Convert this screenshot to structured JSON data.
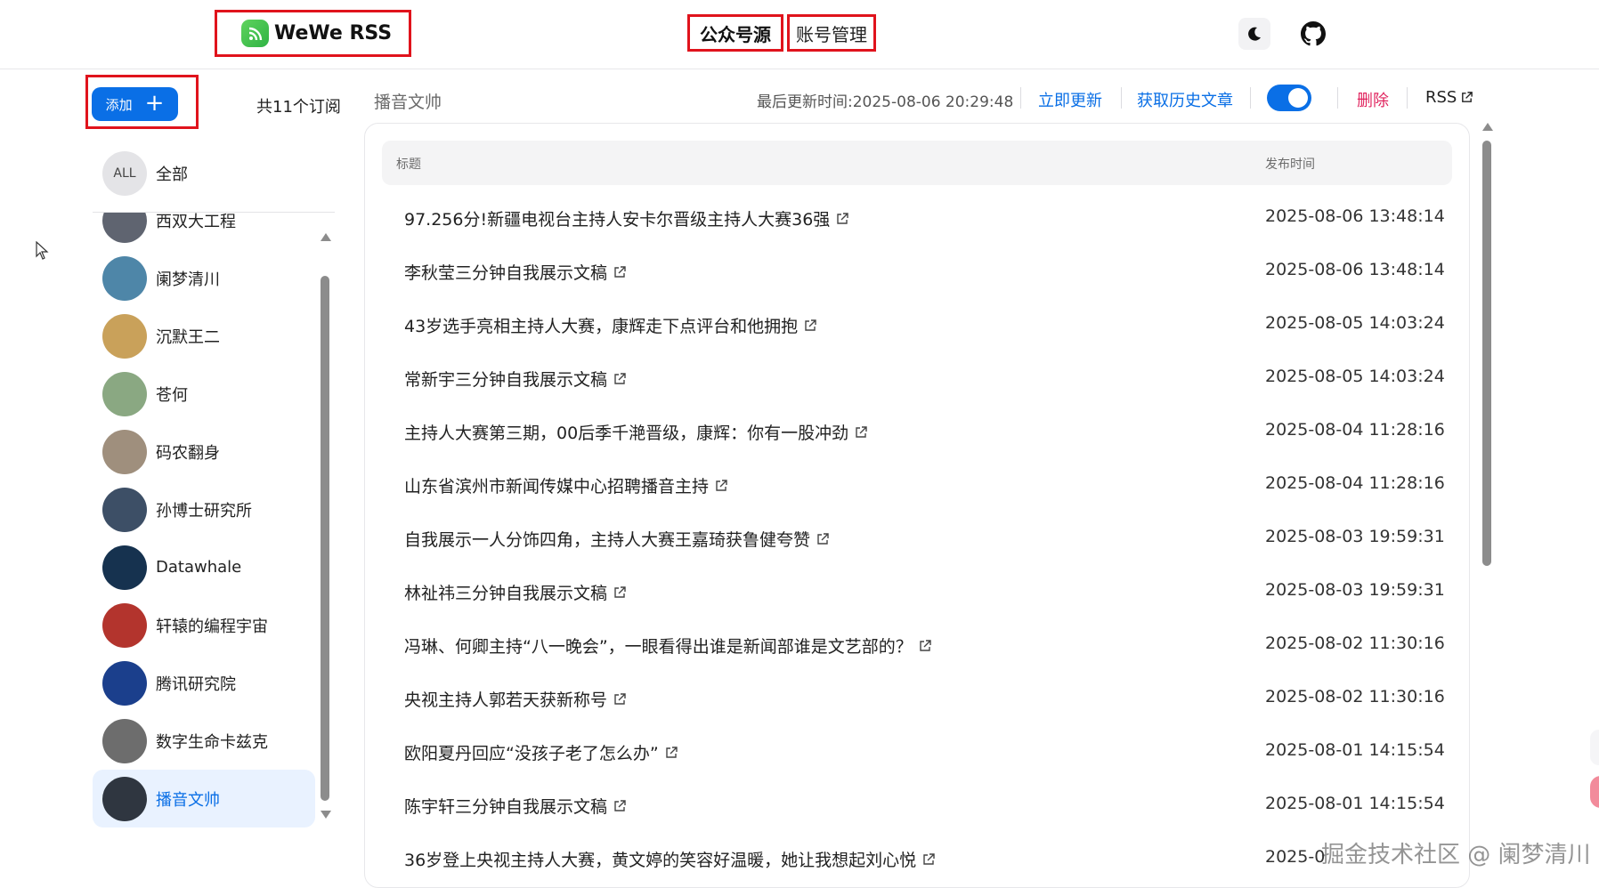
{
  "header": {
    "brand": "WeWe RSS",
    "tabs": [
      {
        "label": "公众号源",
        "active": true
      },
      {
        "label": "账号管理",
        "active": false
      }
    ],
    "icons": [
      "moon-icon",
      "github-icon"
    ]
  },
  "sidebar": {
    "add_label": "添加",
    "add_icon": "+",
    "subscription_count": "共11个订阅",
    "all_item": {
      "avatar": "ALL",
      "label": "全部"
    },
    "items": [
      {
        "label": "西双大工程",
        "color": "#5f6470"
      },
      {
        "label": "阑梦清川",
        "color": "#4e86a8"
      },
      {
        "label": "沉默王二",
        "color": "#c9a15a"
      },
      {
        "label": "苍何",
        "color": "#8aa882"
      },
      {
        "label": "码农翻身",
        "color": "#9f8f7d"
      },
      {
        "label": "孙博士研究所",
        "color": "#3d4f66"
      },
      {
        "label": "Datawhale",
        "color": "#16324f"
      },
      {
        "label": "轩辕的编程宇宙",
        "color": "#b3342d"
      },
      {
        "label": "腾讯研究院",
        "color": "#1b3f8c"
      },
      {
        "label": "数字生命卡兹克",
        "color": "#6d6d6d"
      },
      {
        "label": "播音文帅",
        "color": "#2f3640",
        "active": true
      }
    ]
  },
  "main": {
    "feed_title": "播音文帅",
    "last_update": "最后更新时间:2025-08-06 20:29:48",
    "update_now": "立即更新",
    "fetch_history": "获取历史文章",
    "toggle_on": true,
    "delete": "删除",
    "rss": "RSS",
    "columns": {
      "title": "标题",
      "time": "发布时间"
    },
    "rows": [
      {
        "title": "97.256分!新疆电视台主持人安卡尔晋级主持人大赛36强",
        "time": "2025-08-06 13:48:14"
      },
      {
        "title": "李秋莹三分钟自我展示文稿",
        "time": "2025-08-06 13:48:14"
      },
      {
        "title": "43岁选手亮相主持人大赛，康辉走下点评台和他拥抱",
        "time": "2025-08-05 14:03:24"
      },
      {
        "title": "常新宇三分钟自我展示文稿",
        "time": "2025-08-05 14:03:24"
      },
      {
        "title": "主持人大赛第三期，00后季千滟晋级，康辉：你有一股冲劲",
        "time": "2025-08-04 11:28:16"
      },
      {
        "title": "山东省滨州市新闻传媒中心招聘播音主持",
        "time": "2025-08-04 11:28:16"
      },
      {
        "title": "自我展示一人分饰四角，主持人大赛王嘉琦获鲁健夸赞",
        "time": "2025-08-03 19:59:31"
      },
      {
        "title": "林祉祎三分钟自我展示文稿",
        "time": "2025-08-03 19:59:31"
      },
      {
        "title": "冯琳、何卿主持“八一晚会”，一眼看得出谁是新闻部谁是文艺部的？",
        "time": "2025-08-02 11:30:16"
      },
      {
        "title": "央视主持人郭若天获新称号",
        "time": "2025-08-02 11:30:16"
      },
      {
        "title": "欧阳夏丹回应“没孩子老了怎么办”",
        "time": "2025-08-01 14:15:54"
      },
      {
        "title": "陈宇轩三分钟自我展示文稿",
        "time": "2025-08-01 14:15:54"
      },
      {
        "title": "36岁登上央视主持人大赛，黄文婷的笑容好温暖，她让我想起刘心悦",
        "time": "2025-0"
      }
    ]
  },
  "watermark": "掘金技术社区 @ 阑梦清川"
}
